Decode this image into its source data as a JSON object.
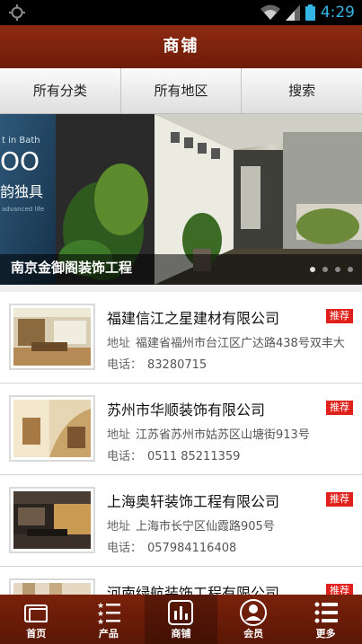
{
  "status_bar": {
    "time": "4:29"
  },
  "header": {
    "title": "商铺"
  },
  "filters": [
    {
      "label": "所有分类"
    },
    {
      "label": "所有地区"
    },
    {
      "label": "搜索"
    }
  ],
  "banner": {
    "caption": "南京金御阁装饰工程",
    "overlay_text_1": "t in Bath",
    "overlay_text_2": "OO",
    "overlay_text_3": "韵独具",
    "overlay_text_4": "advanced life",
    "slides": 4,
    "active_slide": 1
  },
  "companies": [
    {
      "name": "福建信江之星建材有限公司",
      "badge": "推荐",
      "address_label": "地址",
      "address": "福建省福州市台江区广达路438号双丰大",
      "phone_label": "电话：",
      "phone": "83280715"
    },
    {
      "name": "苏州市华顺装饰有限公司",
      "badge": "推荐",
      "address_label": "地址",
      "address": "江苏省苏州市姑苏区山塘街913号",
      "phone_label": "电话：",
      "phone": "0511 85211359"
    },
    {
      "name": " 上海奥轩装饰工程有限公司",
      "badge": "推荐",
      "address_label": "地址",
      "address": "上海市长宁区仙霞路905号",
      "phone_label": "电话：",
      "phone": "057984116408"
    },
    {
      "name": "河南绿航装饰工程有限公司",
      "badge": "推荐",
      "address_label": "",
      "address": "",
      "phone_label": "",
      "phone": ""
    }
  ],
  "bottom_nav": [
    {
      "label": "首页",
      "icon": "home-icon"
    },
    {
      "label": "产品",
      "icon": "list-icon"
    },
    {
      "label": "商铺",
      "icon": "shop-chart-icon",
      "active": true
    },
    {
      "label": "会员",
      "icon": "user-icon"
    },
    {
      "label": "更多",
      "icon": "more-icon"
    }
  ],
  "colors": {
    "primary": "#7a210b",
    "badge": "#e0211b",
    "status_accent": "#33b5e5"
  }
}
